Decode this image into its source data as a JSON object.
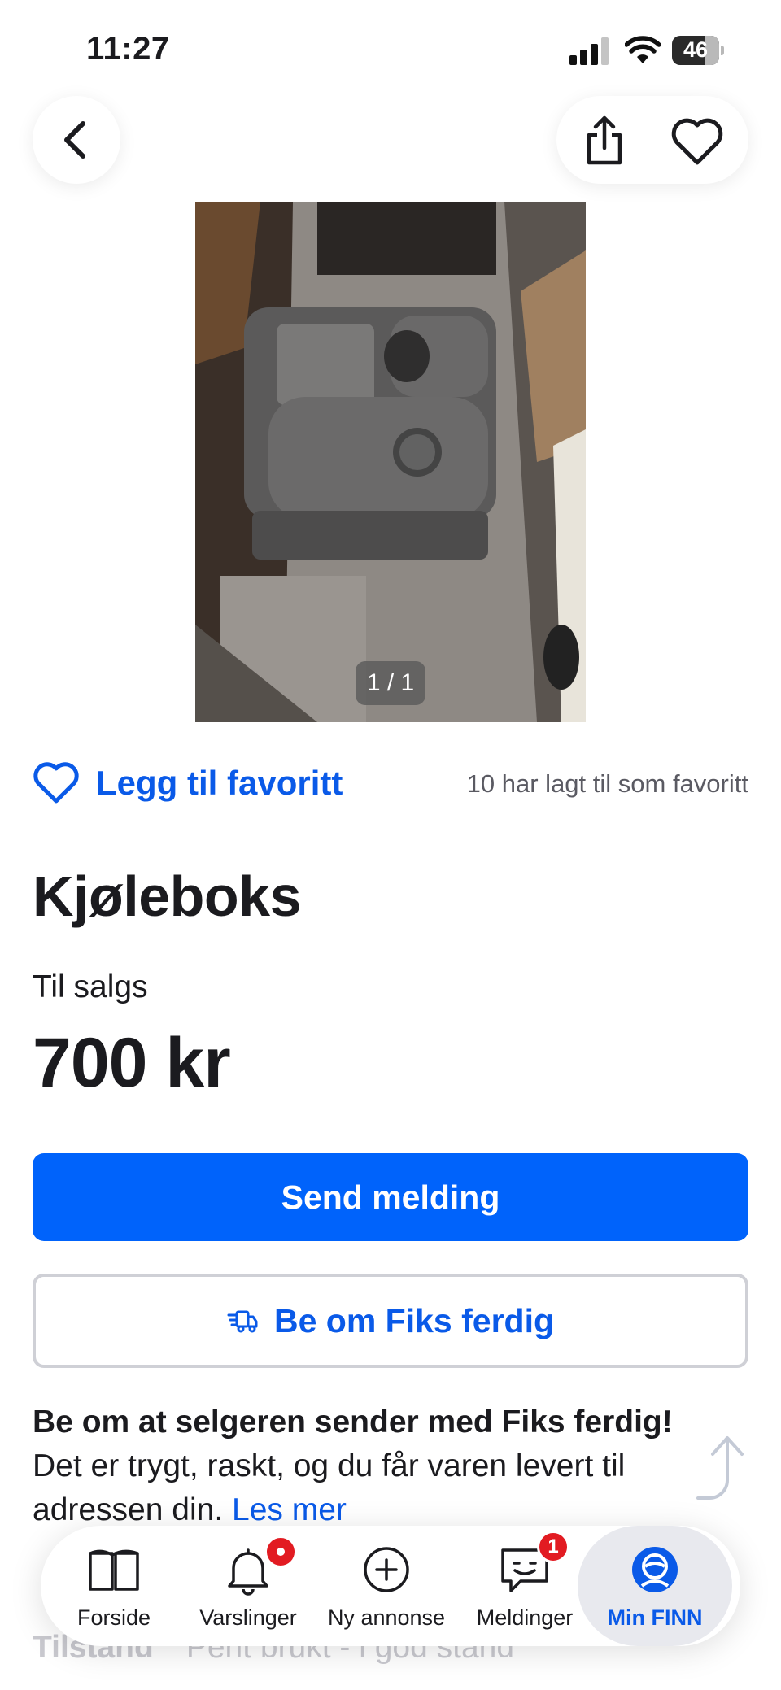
{
  "status_bar": {
    "time": "11:27",
    "battery": "46"
  },
  "gallery": {
    "counter": "1 / 1"
  },
  "favorite": {
    "label": "Legg til favoritt",
    "count_text": "10 har lagt til som favoritt"
  },
  "listing": {
    "title": "Kjøleboks",
    "sale_type": "Til salgs",
    "price": "700 kr"
  },
  "actions": {
    "send_label": "Send melding",
    "fiks_label": "Be om Fiks ferdig"
  },
  "fiks_info": {
    "bold_text": "Be om at selgeren sender med Fiks ferdig!",
    "body_text": " Det er trygt, raskt, og du får varen levert til adressen din. ",
    "link_text": "Les mer"
  },
  "details": {
    "condition_label": "Tilstand",
    "condition_value": "Pent brukt - i god stand"
  },
  "tab_bar": {
    "items": [
      {
        "label": "Forside",
        "icon": "book-icon"
      },
      {
        "label": "Varslinger",
        "icon": "bell-icon"
      },
      {
        "label": "Ny annonse",
        "icon": "plus-circle-icon"
      },
      {
        "label": "Meldinger",
        "icon": "chat-icon",
        "badge": "1"
      },
      {
        "label": "Min FINN",
        "icon": "profile-icon",
        "active": true
      }
    ]
  },
  "colors": {
    "accent": "#0063fb",
    "link": "#0a5ae8",
    "badge": "#e21b22"
  }
}
